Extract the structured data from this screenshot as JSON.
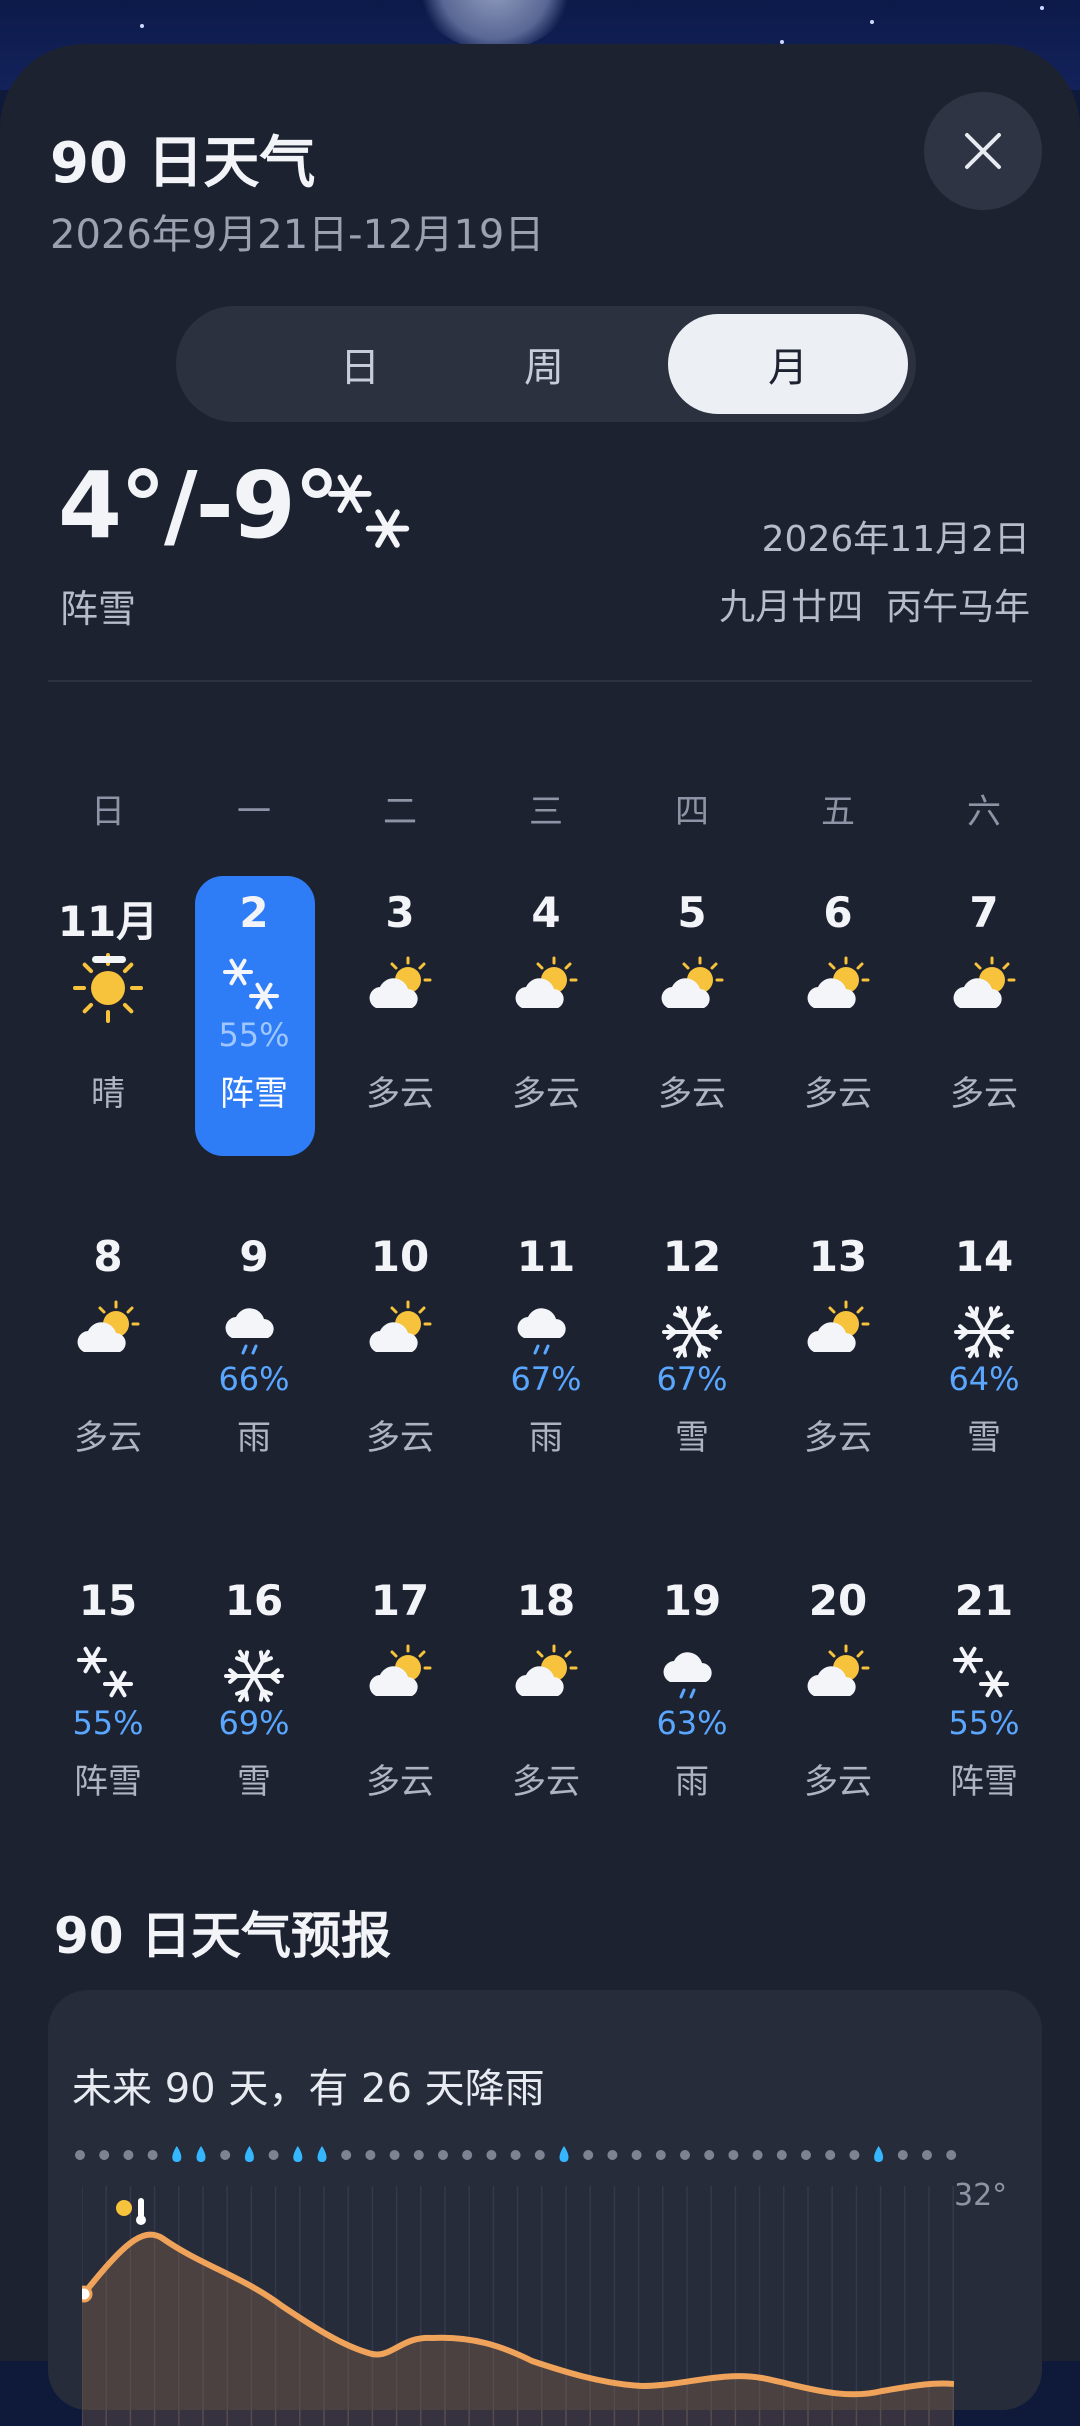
{
  "header": {
    "title": "90 日天气",
    "date_range": "2026年9月21日-12月19日"
  },
  "view_tabs": [
    {
      "label": "日",
      "active": false
    },
    {
      "label": "周",
      "active": false
    },
    {
      "label": "月",
      "active": true
    }
  ],
  "current": {
    "temp": "4°/-9°",
    "condition": "阵雪",
    "icon": "snow-shower-icon",
    "date": "2026年11月2日",
    "lunar": "九月廿四  丙午马年"
  },
  "weekdays": [
    "日",
    "一",
    "二",
    "三",
    "四",
    "五",
    "六"
  ],
  "calendar": [
    [
      {
        "day": "11月",
        "icon": "sun-icon",
        "pct": "",
        "cond": "晴",
        "today": true
      },
      {
        "day": "2",
        "icon": "snow-shower-icon",
        "pct": "55%",
        "cond": "阵雪",
        "selected": true
      },
      {
        "day": "3",
        "icon": "cloudy-sun-icon",
        "pct": "",
        "cond": "多云"
      },
      {
        "day": "4",
        "icon": "cloudy-sun-icon",
        "pct": "",
        "cond": "多云"
      },
      {
        "day": "5",
        "icon": "cloudy-sun-icon",
        "pct": "",
        "cond": "多云"
      },
      {
        "day": "6",
        "icon": "cloudy-sun-icon",
        "pct": "",
        "cond": "多云"
      },
      {
        "day": "7",
        "icon": "cloudy-sun-icon",
        "pct": "",
        "cond": "多云"
      }
    ],
    [
      {
        "day": "8",
        "icon": "cloudy-sun-icon",
        "pct": "",
        "cond": "多云"
      },
      {
        "day": "9",
        "icon": "rain-icon",
        "pct": "66%",
        "cond": "雨"
      },
      {
        "day": "10",
        "icon": "cloudy-sun-icon",
        "pct": "",
        "cond": "多云"
      },
      {
        "day": "11",
        "icon": "rain-icon",
        "pct": "67%",
        "cond": "雨"
      },
      {
        "day": "12",
        "icon": "snowflake-icon",
        "pct": "67%",
        "cond": "雪"
      },
      {
        "day": "13",
        "icon": "cloudy-sun-icon",
        "pct": "",
        "cond": "多云"
      },
      {
        "day": "14",
        "icon": "snowflake-icon",
        "pct": "64%",
        "cond": "雪"
      }
    ],
    [
      {
        "day": "15",
        "icon": "snow-shower-icon",
        "pct": "55%",
        "cond": "阵雪"
      },
      {
        "day": "16",
        "icon": "snowflake-icon",
        "pct": "69%",
        "cond": "雪"
      },
      {
        "day": "17",
        "icon": "cloudy-sun-icon",
        "pct": "",
        "cond": "多云"
      },
      {
        "day": "18",
        "icon": "cloudy-sun-icon",
        "pct": "",
        "cond": "多云"
      },
      {
        "day": "19",
        "icon": "rain-icon",
        "pct": "63%",
        "cond": "雨"
      },
      {
        "day": "20",
        "icon": "cloudy-sun-icon",
        "pct": "",
        "cond": "多云"
      },
      {
        "day": "21",
        "icon": "snow-shower-icon",
        "pct": "55%",
        "cond": "阵雪"
      }
    ]
  ],
  "forecast": {
    "section_title": "90 日天气预报",
    "summary": "未来 90 天，有 26 天降雨",
    "y_max_label": "32°",
    "rain_markers": [
      0,
      0,
      0,
      0,
      1,
      1,
      0,
      1,
      0,
      1,
      1,
      0,
      0,
      0,
      0,
      0,
      0,
      0,
      0,
      0,
      1,
      0,
      0,
      0,
      0,
      0,
      0,
      0,
      0,
      0,
      0,
      0,
      0,
      1,
      0,
      0,
      0
    ],
    "colors": {
      "accent": "#2f7df6",
      "rain": "#35b6ff",
      "temp_line": "#f0a35a"
    }
  }
}
